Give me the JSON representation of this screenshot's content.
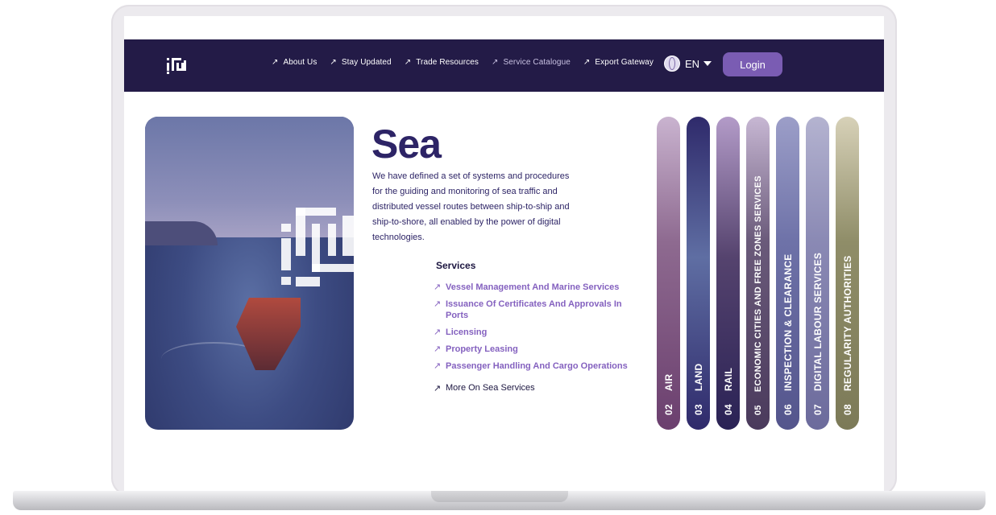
{
  "nav": {
    "links": [
      {
        "label": "About Us",
        "arrow": "↗"
      },
      {
        "label": "Stay Updated",
        "arrow": "↗"
      },
      {
        "label": "Trade Resources",
        "arrow": "↗"
      },
      {
        "label": "Service Catalogue",
        "arrow": "↗"
      },
      {
        "label": "Export Gateway",
        "arrow": "↗"
      }
    ],
    "language": "EN",
    "login": "Login"
  },
  "content": {
    "title": "Sea",
    "description": "We have defined a set of systems and procedures for the guiding and monitoring of sea traffic and distributed vessel routes between ship-to-ship and ship-to-shore, all enabled by the power of digital technologies.",
    "services_heading": "Services",
    "services": [
      "Vessel Management And Marine Services",
      "Issuance Of Certificates And Approvals In Ports",
      "Licensing",
      "Property Leasing",
      "Passenger Handling And Cargo Operations"
    ],
    "service_arrow": "↗",
    "more": "More On Sea Services"
  },
  "tabs": [
    {
      "num": "02",
      "label": "AIR",
      "color": "#6b3f6e"
    },
    {
      "num": "03",
      "label": "LAND",
      "color": "#2f2a6b"
    },
    {
      "num": "04",
      "label": "RAIL",
      "color": "#2a2255"
    },
    {
      "num": "05",
      "label": "ECONOMIC CITIES AND FREE ZONES SERVICES",
      "color": "#4a3a5c"
    },
    {
      "num": "06",
      "label": "INSPECTION & CLEARANCE",
      "color": "#54558c"
    },
    {
      "num": "07",
      "label": "DIGITAL LABOUR SERVICES",
      "color": "#6c6b9c"
    },
    {
      "num": "08",
      "label": "REGULARITY AUTHORITIES",
      "color": "#7c7a58"
    }
  ]
}
